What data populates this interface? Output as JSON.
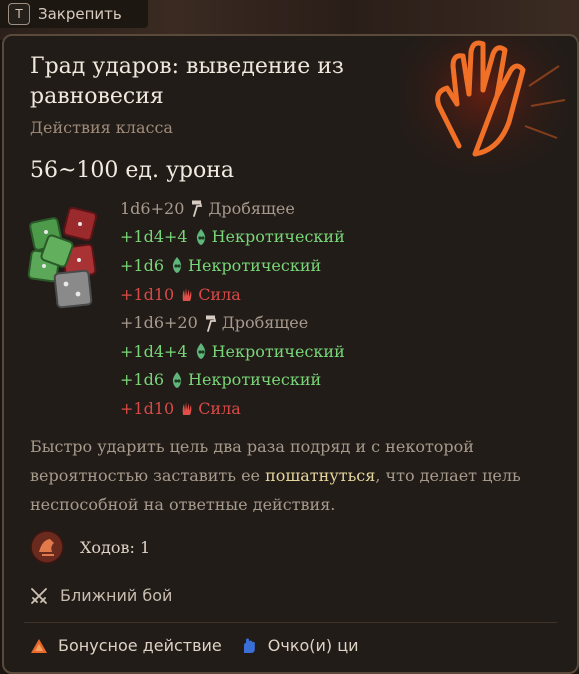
{
  "pin_bar": {
    "key": "T",
    "label": "Закрепить"
  },
  "tooltip": {
    "title": "Град ударов: выведение из равновесия",
    "subtitle": "Действия класса",
    "damage_total": "56~100 ед. урона",
    "damage_rows": [
      {
        "amount": "1d6+20",
        "type": "Дробящее",
        "color": "gray",
        "icon": "blunt-weapon-icon"
      },
      {
        "amount": "+1d4+4",
        "type": "Некротический",
        "color": "green",
        "icon": "necrotic-icon"
      },
      {
        "amount": "+1d6",
        "type": "Некротический",
        "color": "green",
        "icon": "necrotic-icon"
      },
      {
        "amount": "+1d10",
        "type": "Сила",
        "color": "red",
        "icon": "force-icon"
      },
      {
        "amount": "+1d6+20",
        "type": "Дробящее",
        "color": "gray",
        "icon": "blunt-weapon-icon"
      },
      {
        "amount": "+1d4+4",
        "type": "Некротический",
        "color": "green",
        "icon": "necrotic-icon"
      },
      {
        "amount": "+1d6",
        "type": "Некротический",
        "color": "green",
        "icon": "necrotic-icon"
      },
      {
        "amount": "+1d10",
        "type": "Сила",
        "color": "red",
        "icon": "force-icon"
      }
    ],
    "description": {
      "before": "Быстро ударить цель два раза подряд и с некоторой вероятностью заставить ее ",
      "highlight": "пошатнуться",
      "after": ", что делает цель неспособной на ответные действия."
    },
    "turns_label": "Ходов: 1",
    "range_label": "Ближний бой",
    "costs": [
      {
        "label": "Бонусное действие",
        "icon": "bonus-action-icon"
      },
      {
        "label": "Очко(и) ци",
        "icon": "ki-point-icon"
      }
    ]
  },
  "colors": {
    "gray": "#a69a8e",
    "green": "#78d678",
    "red": "#d84a48",
    "highlight": "#e6d69c",
    "accent_orange": "#e86a2a",
    "ki_blue": "#3a6fd8"
  }
}
